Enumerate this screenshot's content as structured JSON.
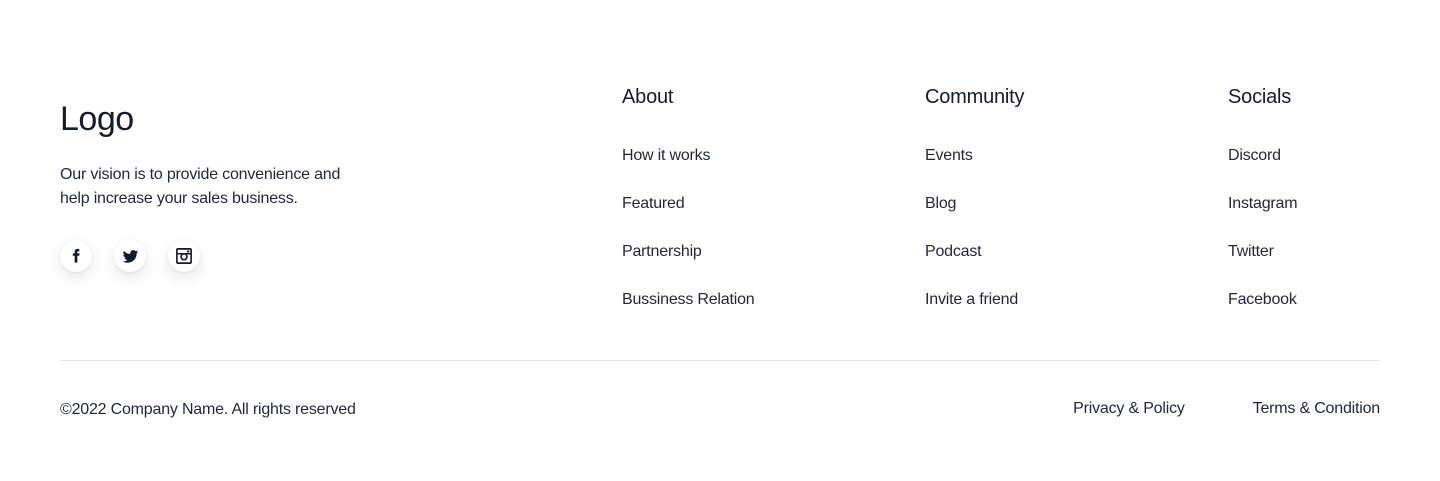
{
  "brand": {
    "logo": "Logo",
    "vision": "Our vision is to provide convenience and help increase your sales business."
  },
  "social_icons": [
    {
      "name": "facebook-icon"
    },
    {
      "name": "twitter-icon"
    },
    {
      "name": "instagram-icon"
    }
  ],
  "columns": {
    "about": {
      "title": "About",
      "links": [
        "How it works",
        "Featured",
        "Partnership",
        "Bussiness Relation"
      ]
    },
    "community": {
      "title": "Community",
      "links": [
        "Events",
        "Blog",
        "Podcast",
        "Invite a friend"
      ]
    },
    "socials": {
      "title": "Socials",
      "links": [
        "Discord",
        "Instagram",
        "Twitter",
        "Facebook"
      ]
    }
  },
  "bottom": {
    "copyright": "©2022 Company Name. All rights reserved",
    "privacy": "Privacy & Policy",
    "terms": "Terms & Condition"
  },
  "colors": {
    "text": "#1f2836",
    "heading": "#141b2a",
    "divider": "#e6e8ec",
    "background": "#ffffff"
  }
}
